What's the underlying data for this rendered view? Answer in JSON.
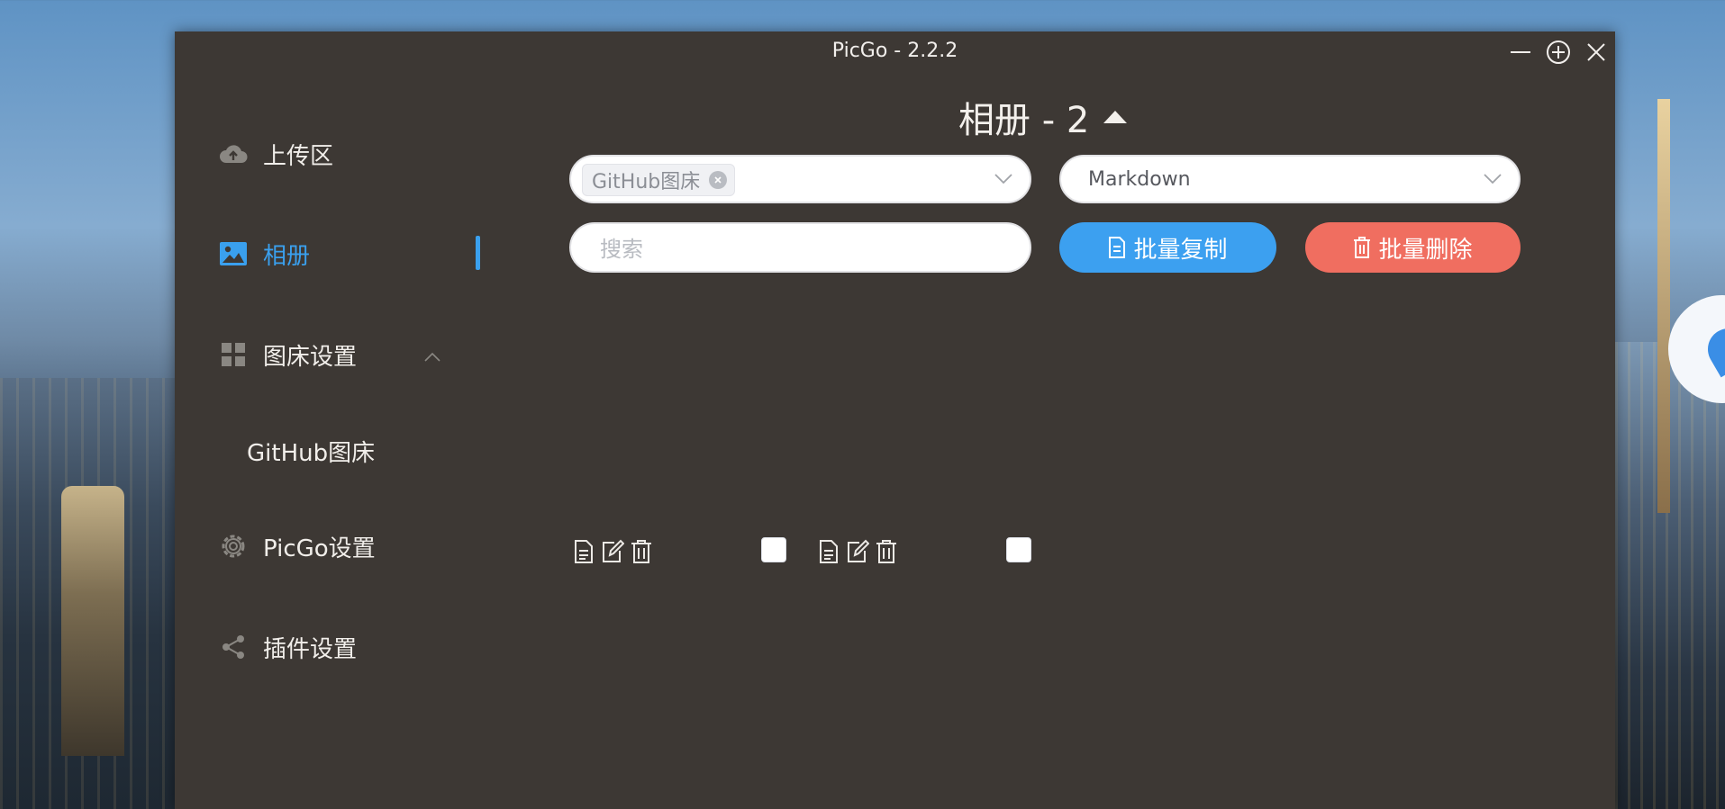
{
  "window": {
    "title": "PicGo - 2.2.2"
  },
  "sidebar": {
    "items": [
      {
        "label": "上传区",
        "icon": "cloud-upload-icon"
      },
      {
        "label": "相册",
        "icon": "image-icon",
        "active": true
      },
      {
        "label": "图床设置",
        "icon": "grid-icon"
      },
      {
        "label": "GitHub图床"
      },
      {
        "label": "PicGo设置",
        "icon": "gear-icon"
      },
      {
        "label": "插件设置",
        "icon": "share-icon"
      }
    ]
  },
  "gallery": {
    "title": "相册 - 2",
    "picbed_filter": {
      "tag": "GitHub图床"
    },
    "format_select": {
      "value": "Markdown"
    },
    "search": {
      "placeholder": "搜索",
      "value": ""
    },
    "batch_copy_label": "批量复制",
    "batch_delete_label": "批量删除",
    "items": [
      {
        "checked": false
      },
      {
        "checked": false
      }
    ]
  },
  "colors": {
    "window_bg": "#3d3834",
    "accent": "#3aa0ee",
    "danger": "#f06e60"
  }
}
